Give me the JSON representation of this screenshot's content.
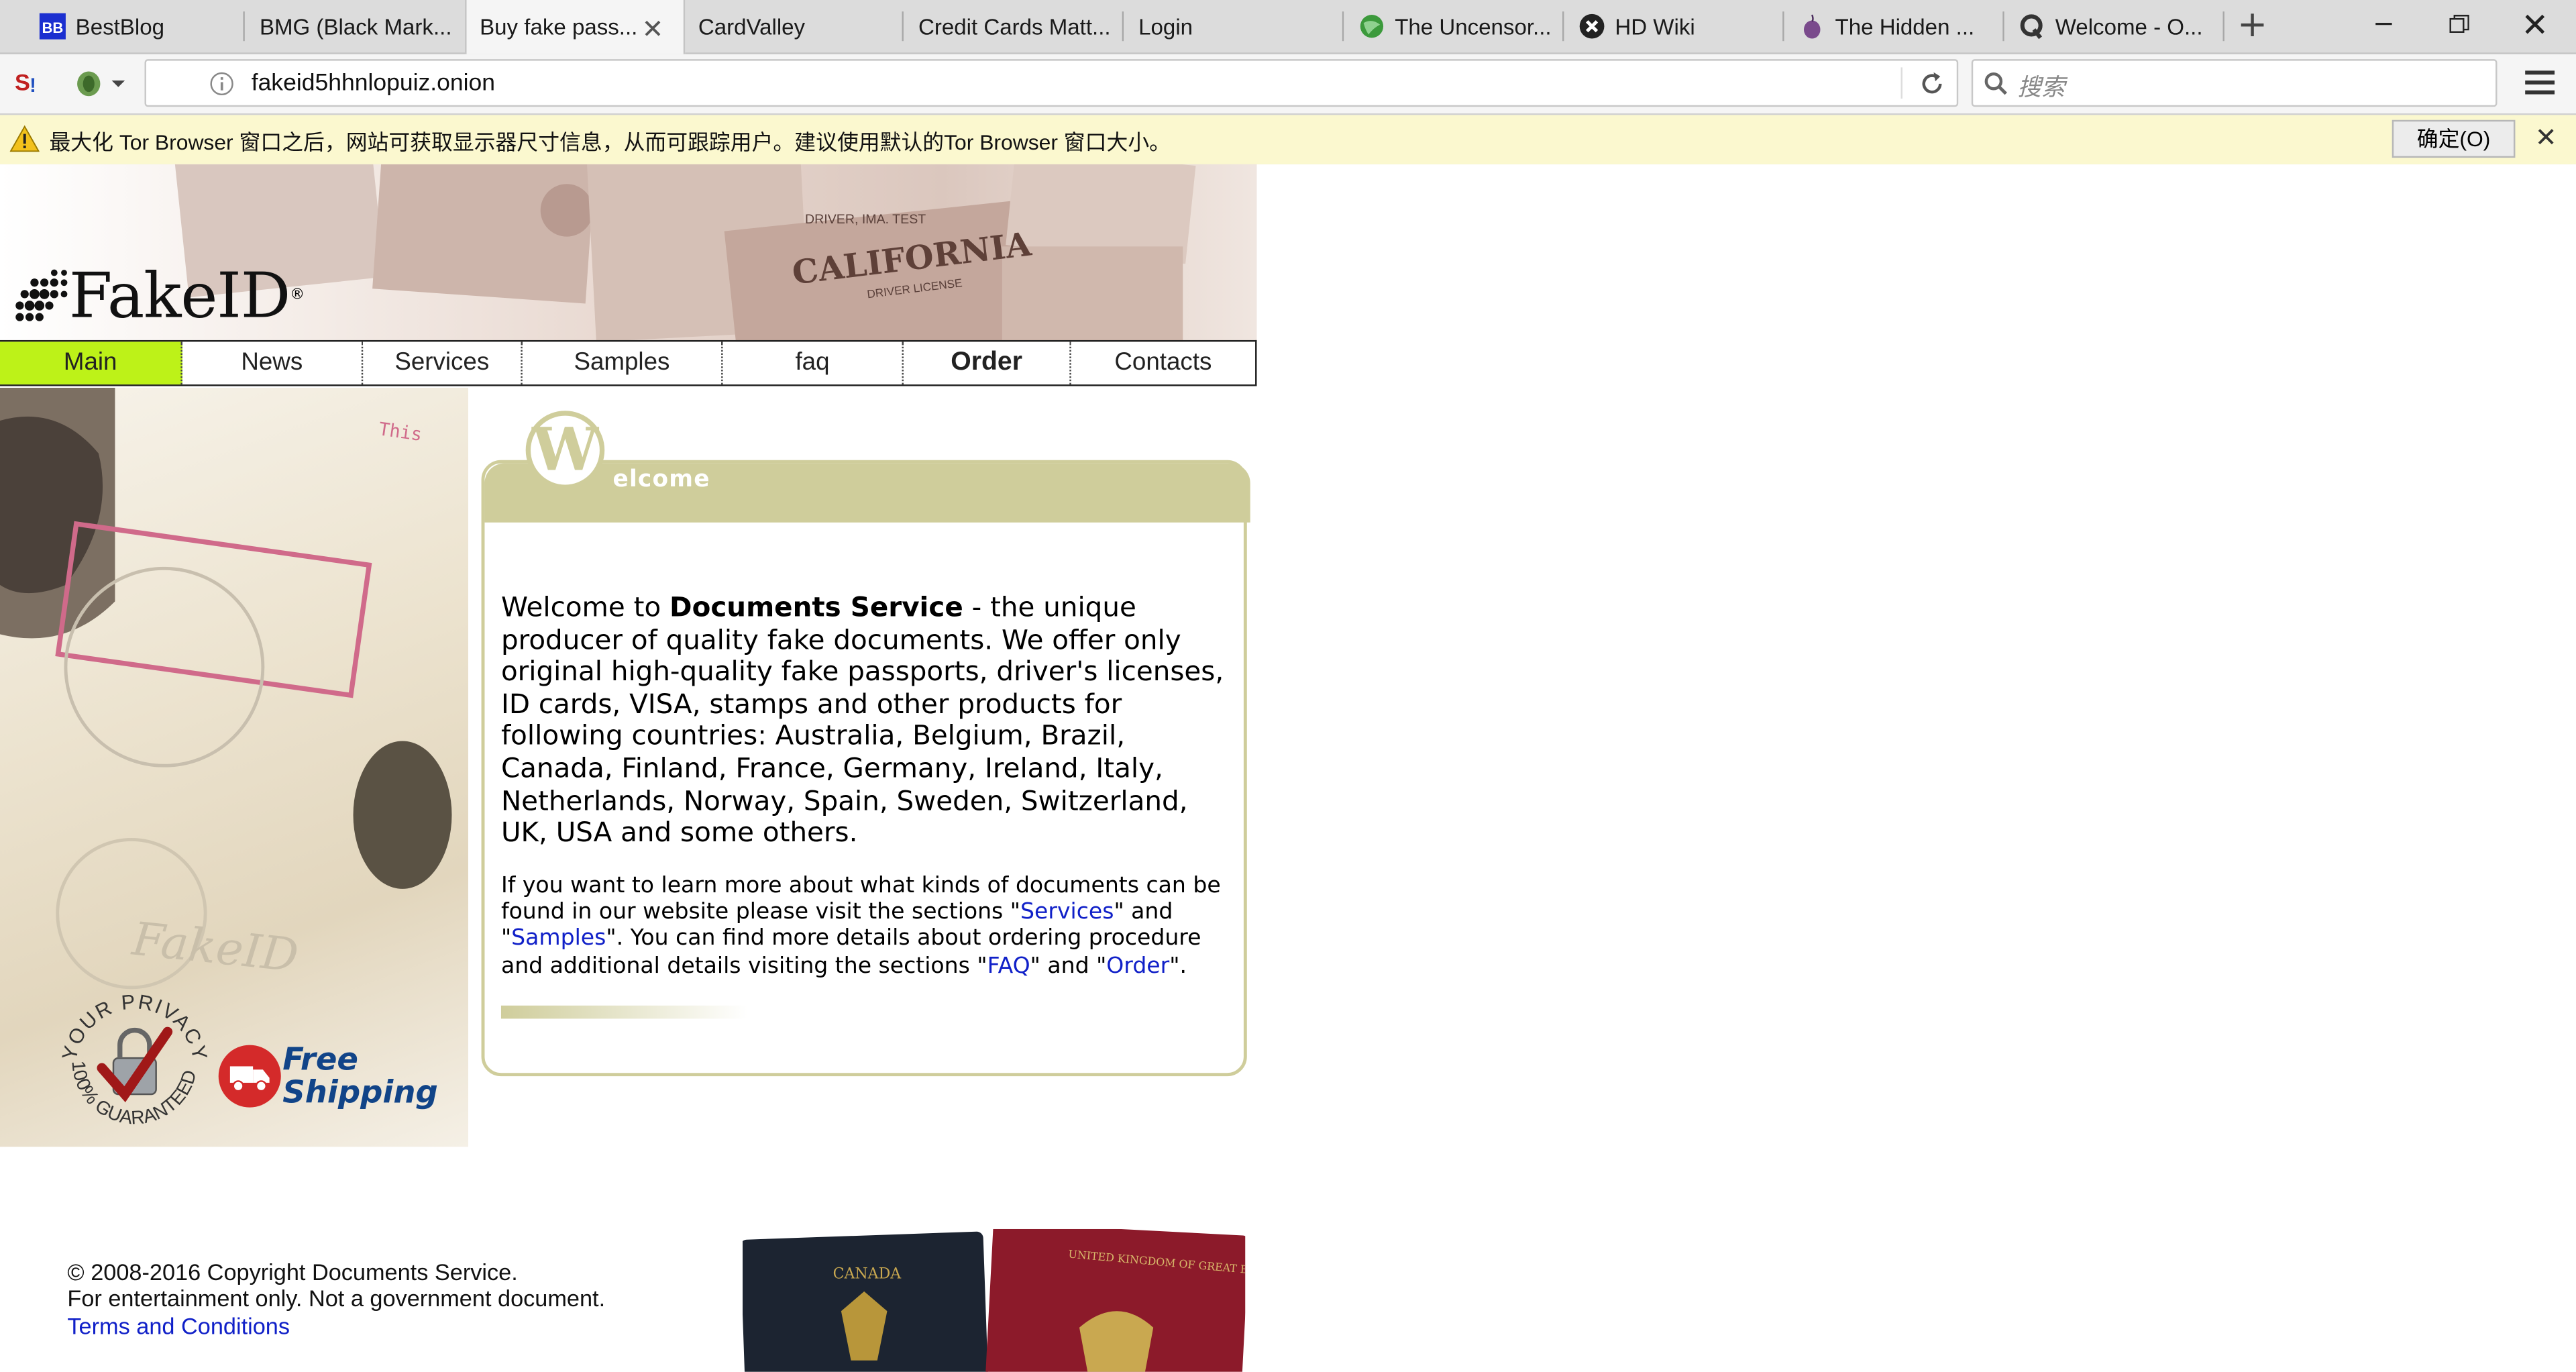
{
  "browser": {
    "tabs": [
      {
        "label": "BestBlog",
        "icon": "bb-favicon-icon",
        "active": false
      },
      {
        "label": "BMG (Black Mark...",
        "icon": "",
        "active": false
      },
      {
        "label": "Buy fake pass...",
        "icon": "",
        "active": true
      },
      {
        "label": "CardValley",
        "icon": "",
        "active": false
      },
      {
        "label": "Credit Cards Matt...",
        "icon": "",
        "active": false
      },
      {
        "label": "Login",
        "icon": "",
        "active": false
      },
      {
        "label": "The Uncensor...",
        "icon": "globe-icon",
        "active": false
      },
      {
        "label": "HD Wiki",
        "icon": "x-circle-icon",
        "active": false
      },
      {
        "label": "The Hidden ...",
        "icon": "onion-icon",
        "active": false
      },
      {
        "label": "Welcome - O...",
        "icon": "q-icon",
        "active": false
      }
    ],
    "url": "fakeid5hhnlopuiz.onion",
    "search_placeholder": "搜索"
  },
  "notification": {
    "message": "最大化 Tor Browser 窗口之后，网站可获取显示器尺寸信息，从而可跟踪用户。建议使用默认的Tor Browser 窗口大小。",
    "ok_label": "确定(O)"
  },
  "site": {
    "logo": "FakeID",
    "logo_mark": "®",
    "menu": [
      "Main",
      "News",
      "Services",
      "Samples",
      "faq",
      "Order",
      "Contacts"
    ],
    "welcome_heading": "elcome",
    "welcome_initial": "W",
    "intro_pre": "Welcome to ",
    "intro_bold": "Documents Service",
    "intro_post": " - the unique producer of quality fake documents. We offer only original high-quality fake passports, driver's licenses, ID cards, VISA, stamps and other products for following countries: Australia, Belgium, Brazil, Canada, Finland, France, Germany, Ireland, Italy, Netherlands, Norway, Spain, Sweden, Switzerland, UK, USA and some others.",
    "more_1": "If you want to learn more about what kinds of documents can be found in our website please visit the sections \"",
    "link_services": "Services",
    "more_2": "\" and \"",
    "link_samples": "Samples",
    "more_3": "\". You can find more details about ordering procedure and additional details visiting the sections \"",
    "link_faq": "FAQ",
    "more_4": "\" and \"",
    "link_order": "Order",
    "more_5": "\".",
    "badge_privacy_top": "YOUR PRIVACY",
    "badge_privacy_bottom": "100% GUARANTEED",
    "free_shipping_1": "Free",
    "free_shipping_2": "Shipping",
    "banner_text_1": "DRIVER, IMA. TEST",
    "banner_text_2": "CALIFORNIA",
    "banner_text_3": "DRIVER LICENSE",
    "passport_1": "CANADA",
    "passport_2": "UNITED KINGDOM OF GREAT BRITAIN AND NORTHERN IRELAND",
    "left_watermark": "FakeID",
    "footer_copyright": "© 2008-2016 Copyright Documents Service.",
    "footer_disclaimer": "For entertainment only. Not a government document.",
    "footer_terms": "Terms and Conditions"
  },
  "colors": {
    "menu_active": "#bdf218",
    "welcome_frame": "#cfcd9b",
    "link": "#1020c8",
    "notice_bg": "#fbf8cf"
  }
}
